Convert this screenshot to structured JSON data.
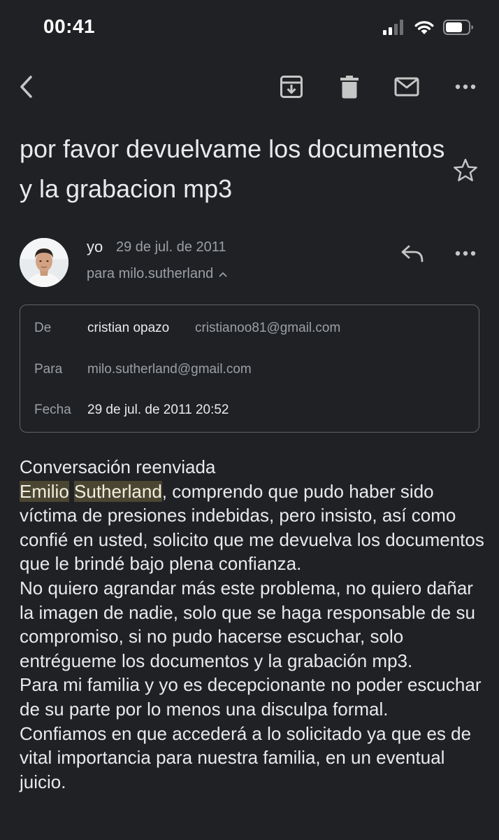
{
  "status_bar": {
    "time": "00:41"
  },
  "subject": "por favor devuelvame los documentos y la grabacion mp3",
  "message": {
    "sender": "yo",
    "date": "29 de jul. de 2011",
    "recipient_summary": "para milo.sutherland"
  },
  "details": {
    "from_label": "De",
    "from_name": "cristian opazo",
    "from_email": "cristianoo81@gmail.com",
    "to_label": "Para",
    "to_email": "milo.sutherland@gmail.com",
    "date_label": "Fecha",
    "date_value": "29 de jul. de 2011 20:52"
  },
  "body": {
    "heading": "Conversación reenviada",
    "highlight_1": "Emilio",
    "highlight_2": "Sutherland",
    "p1_rest": ", comprendo que pudo haber sido víctima de  presiones indebidas, pero insisto, así como confié en usted, solicito que me devuelva los documentos que le brindé bajo plena confianza.",
    "p2": "No quiero agrandar más este problema, no quiero dañar la imagen de nadie, solo que se haga responsable de su compromiso, si no pudo hacerse escuchar, solo entrégueme los documentos y la grabación mp3.",
    "p3": "Para mi familia y yo es decepcionante no poder escuchar de su parte por lo menos una disculpa formal.",
    "p4": "Confiamos en que accederá a lo solicitado ya que es de vital importancia para nuestra familia, en un eventual juicio."
  },
  "icons": {
    "back": "chevron-left-icon",
    "archive": "archive-icon",
    "delete": "trash-icon",
    "mark_unread": "mail-icon",
    "more": "more-horizontal-icon",
    "star": "star-icon",
    "reply": "reply-icon",
    "expand": "chevron-up-icon",
    "signal": "cellular-signal-icon",
    "wifi": "wifi-icon",
    "battery": "battery-icon"
  },
  "colors": {
    "background": "#202124",
    "text": "#e8eaed",
    "secondary": "#9aa0a6",
    "highlight": "#4b4632"
  }
}
